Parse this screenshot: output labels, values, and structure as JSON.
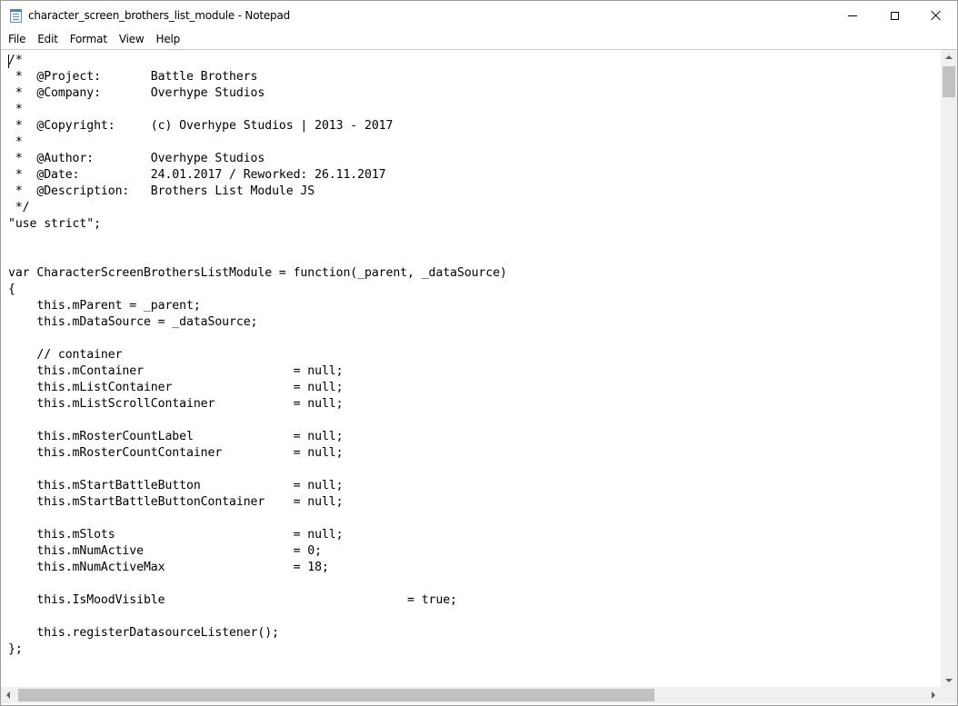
{
  "window": {
    "title": "character_screen_brothers_list_module - Notepad"
  },
  "icons": {
    "app": "notepad-icon",
    "minimize": "minimize-icon",
    "maximize": "maximize-icon",
    "close": "close-icon"
  },
  "menu": {
    "items": [
      "File",
      "Edit",
      "Format",
      "View",
      "Help"
    ]
  },
  "editor": {
    "content": "/*\n *  @Project:       Battle Brothers\n *  @Company:       Overhype Studios\n *\n *  @Copyright:     (c) Overhype Studios | 2013 - 2017\n *\n *  @Author:        Overhype Studios\n *  @Date:          24.01.2017 / Reworked: 26.11.2017\n *  @Description:   Brothers List Module JS\n */\n\"use strict\";\n\n\nvar CharacterScreenBrothersListModule = function(_parent, _dataSource)\n{\n    this.mParent = _parent;\n    this.mDataSource = _dataSource;\n\n    // container\n    this.mContainer                     = null;\n    this.mListContainer                 = null;\n    this.mListScrollContainer           = null;\n\n    this.mRosterCountLabel              = null;\n    this.mRosterCountContainer          = null;\n\n    this.mStartBattleButton             = null;\n    this.mStartBattleButtonContainer    = null;\n\n    this.mSlots                         = null;\n    this.mNumActive                     = 0;\n    this.mNumActiveMax                  = 18;\n\n    this.IsMoodVisible                                  = true;\n\n    this.registerDatasourceListener();\n};"
  },
  "colors": {
    "window_bg": "#ffffff",
    "scrollbar_track": "#f0f0f0",
    "scrollbar_thumb": "#c1c1c1",
    "text": "#000000"
  }
}
